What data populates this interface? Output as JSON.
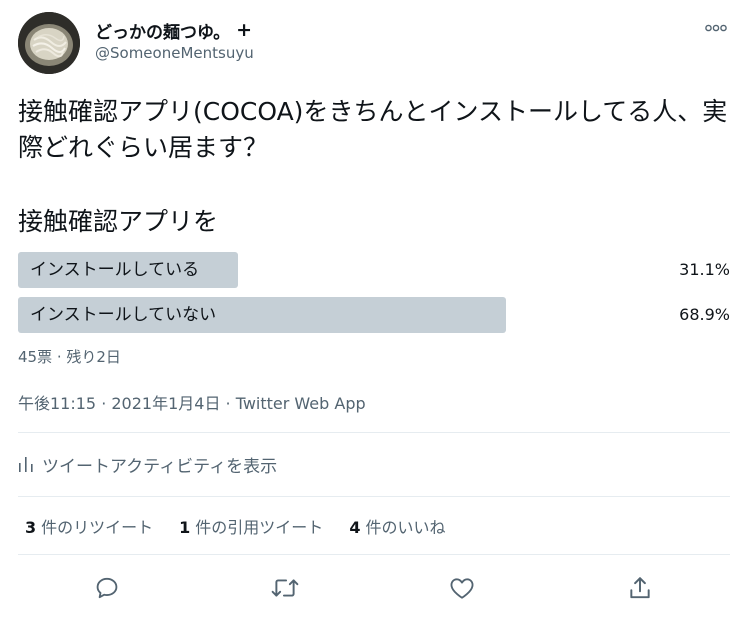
{
  "tweet": {
    "display_name": "どっかの麺つゆ。",
    "name_badge": "+",
    "handle": "@SomeoneMentsuyu",
    "text": "接触確認アプリ(COCOA)をきちんとインストールしてる人、実際どれぐらい居ます？"
  },
  "poll": {
    "question": "接触確認アプリを",
    "options": [
      {
        "label": "インストールしている",
        "percent_text": "31.1%",
        "percent": 31.1,
        "winner": false
      },
      {
        "label": "インストールしていない",
        "percent_text": "68.9%",
        "percent": 68.9,
        "winner": true
      }
    ],
    "meta": "45票 · 残り2日"
  },
  "timestamp": {
    "text": "午後11:15 · 2021年1月4日 · Twitter Web App"
  },
  "activity": {
    "label": "ツイートアクティビティを表示"
  },
  "stats": {
    "retweets": {
      "count": "3",
      "label": "件のリツイート"
    },
    "quotes": {
      "count": "1",
      "label": "件の引用ツイート"
    },
    "likes": {
      "count": "4",
      "label": "件のいいね"
    }
  },
  "colors": {
    "poll_bar": "#c5cfd6",
    "secondary_text": "#536471",
    "primary_text": "#0f1419",
    "divider": "#e6ecf0"
  },
  "icons": {
    "more": "more-horizontal-icon",
    "activity": "bar-chart-icon",
    "reply": "reply-icon",
    "retweet": "retweet-icon",
    "like": "heart-icon",
    "share": "share-icon"
  }
}
